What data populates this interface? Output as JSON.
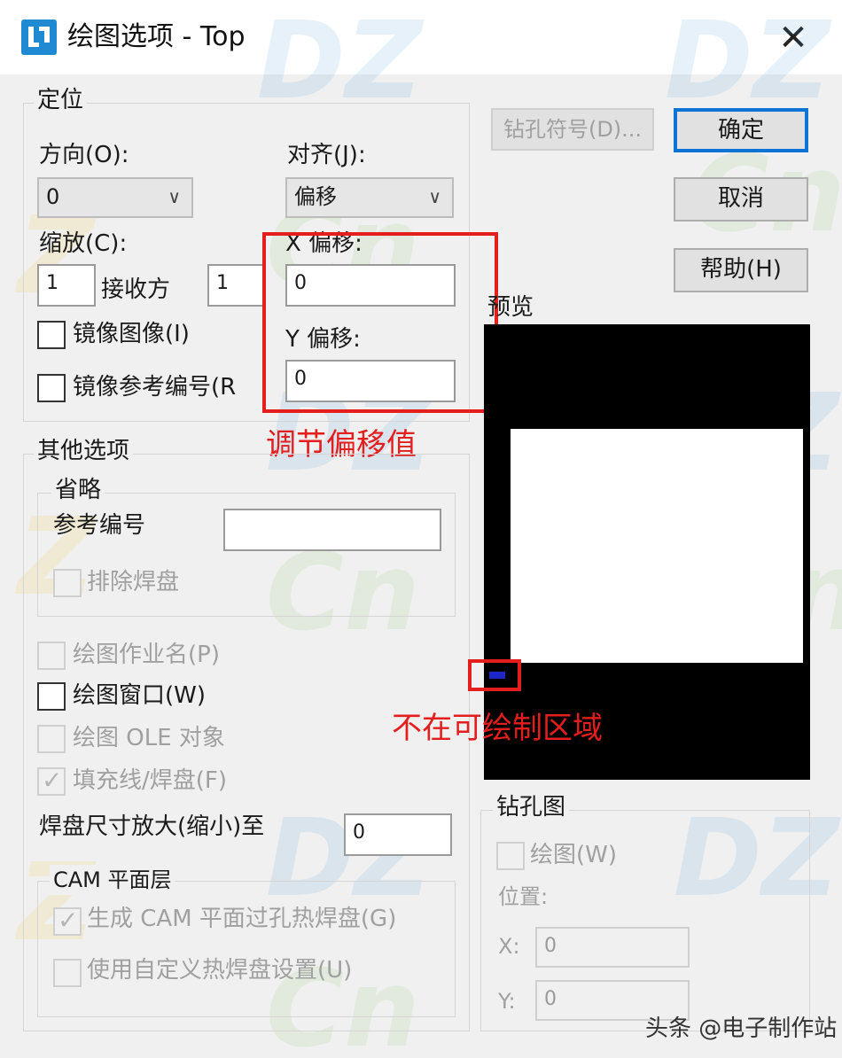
{
  "window": {
    "title": "绘图选项 - Top",
    "close_symbol": "✕"
  },
  "positioning": {
    "legend": "定位",
    "direction_label": "方向(O):",
    "direction_value": "0",
    "align_label": "对齐(J):",
    "align_value": "偏移",
    "scale_label": "缩放(C):",
    "scale_x_value": "1",
    "receive_label": "接收方",
    "scale_y_value": "1",
    "x_offset_label": "X 偏移:",
    "x_offset_value": "0",
    "y_offset_label": "Y 偏移:",
    "y_offset_value": "0",
    "mirror_image_label": "镜像图像(I)",
    "mirror_image_checked": false,
    "mirror_ref_label": "镜像参考编号(R",
    "mirror_ref_checked": false
  },
  "other_options": {
    "legend": "其他选项",
    "omit": {
      "legend": "省略",
      "ref_number_label": "参考编号",
      "ref_number_value": "",
      "exclude_pads_label": "排除焊盘"
    },
    "plot_job_name_label": "绘图作业名(P)",
    "plot_window_label": "绘图窗口(W)",
    "plot_ole_label": "绘图 OLE 对象",
    "fill_lines_label": "填充线/焊盘(F)",
    "fill_lines_checked": true,
    "pad_scale_label": "焊盘尺寸放大(缩小)至",
    "pad_scale_value": "0",
    "cam_plane": {
      "legend": "CAM 平面层",
      "gen_thermals_label": "生成 CAM 平面过孔热焊盘(G)",
      "gen_thermals_checked": true,
      "custom_thermals_label": "使用自定义热焊盘设置(U)"
    }
  },
  "buttons": {
    "drill_symbol": "钻孔符号(D)...",
    "ok": "确定",
    "cancel": "取消",
    "help": "帮助(H)"
  },
  "preview": {
    "label": "预览"
  },
  "drill_drawing": {
    "legend": "钻孔图",
    "plot_label": "绘图(W)",
    "position_label": "位置:",
    "x_label": "X:",
    "x_value": "0",
    "y_label": "Y:",
    "y_value": "0"
  },
  "annotations": {
    "adjust_offset": "调节偏移值",
    "out_of_area": "不在可绘制区域"
  },
  "watermark": {
    "text_dz": "DZ",
    "text_z": "Z",
    "text_cn": "Cn"
  },
  "footer": {
    "credit": "头条 @电子制作站"
  },
  "colors": {
    "annotation_red": "#e41d1d",
    "accent_blue": "#0b74d4",
    "preview_bg": "#000000"
  }
}
